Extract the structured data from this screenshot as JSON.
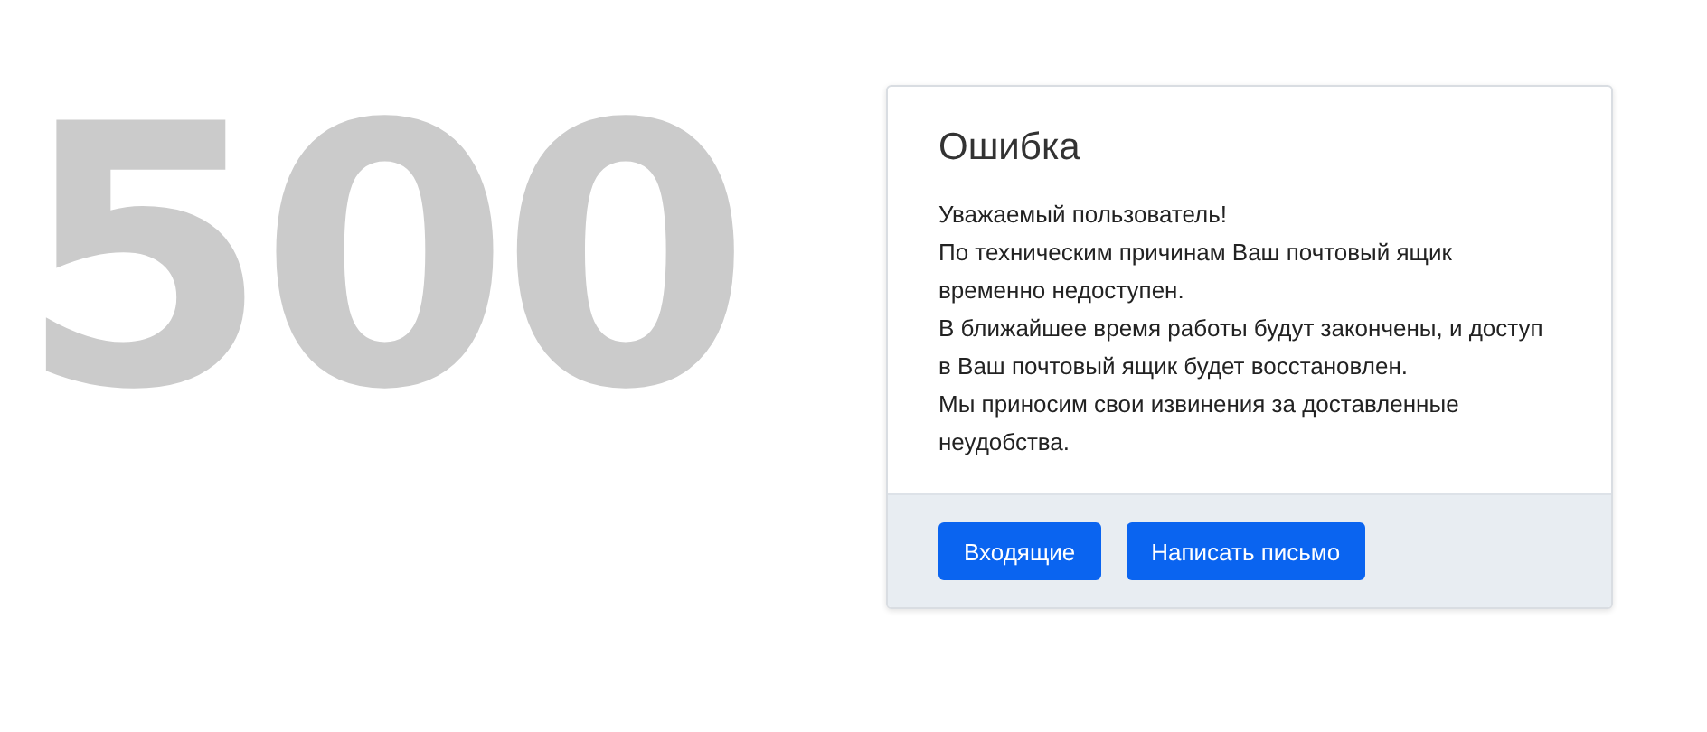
{
  "error_code": "500",
  "card": {
    "title": "Ошибка",
    "paragraphs": [
      "Уважаемый пользователь!",
      "По техническим причинам Ваш почтовый ящик временно недоступен.",
      "В ближайшее время работы будут закончены, и доступ в Ваш почтовый ящик будет восстановлен.",
      "Мы приносим свои извинения за доставленные неудобства."
    ],
    "buttons": [
      "Входящие",
      "Написать письмо"
    ]
  }
}
